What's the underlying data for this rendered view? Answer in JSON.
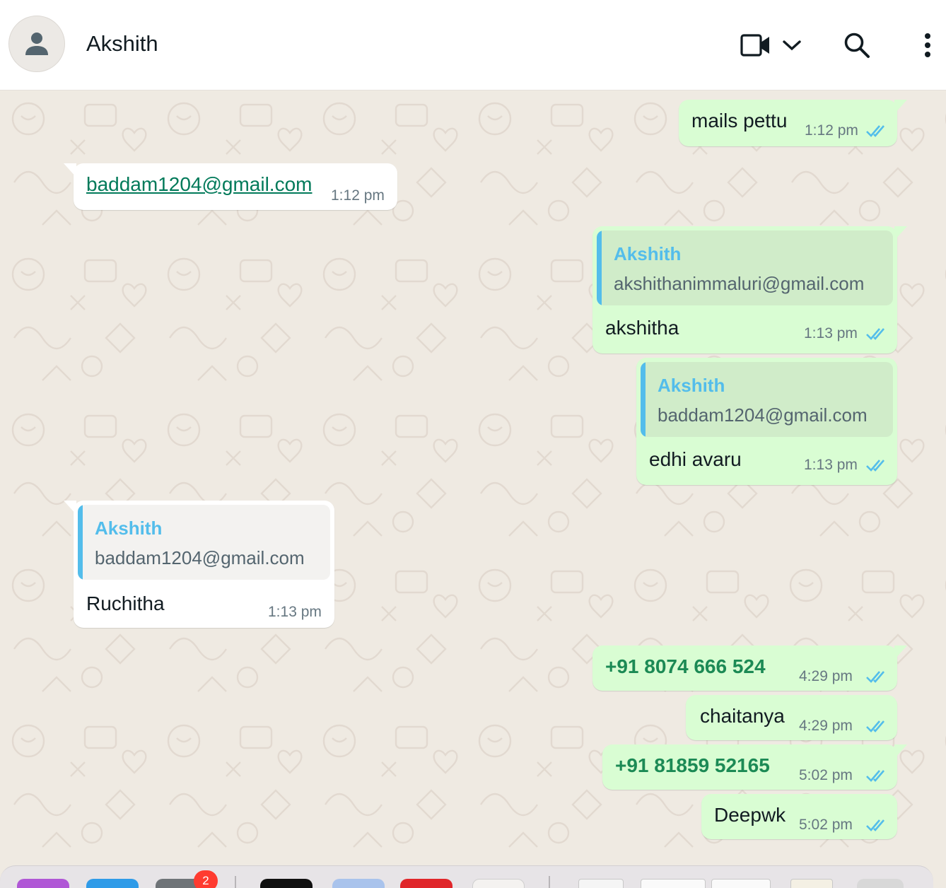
{
  "header": {
    "contact_name": "Akshith",
    "icons": [
      "avatar-person-icon",
      "video-call-icon",
      "chevron-down-icon",
      "search-icon",
      "more-options-icon"
    ]
  },
  "messages": [
    {
      "direction": "out",
      "text": "mails pettu",
      "time": "1:12 pm",
      "status": "read"
    },
    {
      "direction": "in",
      "text": "baddam1204@gmail.com",
      "time": "1:12 pm",
      "kind": "link"
    },
    {
      "direction": "out",
      "quote_name": "Akshith",
      "quote_text": "akshithanimmaluri@gmail.com",
      "text": "akshitha",
      "time": "1:13 pm",
      "status": "read"
    },
    {
      "direction": "out",
      "quote_name": "Akshith",
      "quote_text": "baddam1204@gmail.com",
      "text": "edhi avaru",
      "time": "1:13 pm",
      "status": "read"
    },
    {
      "direction": "in",
      "quote_name": "Akshith",
      "quote_text": "baddam1204@gmail.com",
      "text": "Ruchitha",
      "time": "1:13 pm"
    },
    {
      "direction": "out",
      "text": "+91 8074 666 524",
      "time": "4:29 pm",
      "status": "read",
      "kind": "phone"
    },
    {
      "direction": "out",
      "text": "chaitanya",
      "time": "4:29 pm",
      "status": "read"
    },
    {
      "direction": "out",
      "text": "+91 81859 52165",
      "time": "5:02 pm",
      "status": "read",
      "kind": "phone"
    },
    {
      "direction": "out",
      "text": "Deepwk",
      "time": "5:02 pm",
      "status": "read"
    }
  ],
  "dock": {
    "badge_count": "2"
  },
  "colors": {
    "outgoing_bubble": "#d9fdd3",
    "incoming_bubble": "#ffffff",
    "chat_background": "#efeae2",
    "read_ticks": "#53bdeb",
    "quote_bar": "#53bdeb",
    "link": "#027a5a"
  }
}
